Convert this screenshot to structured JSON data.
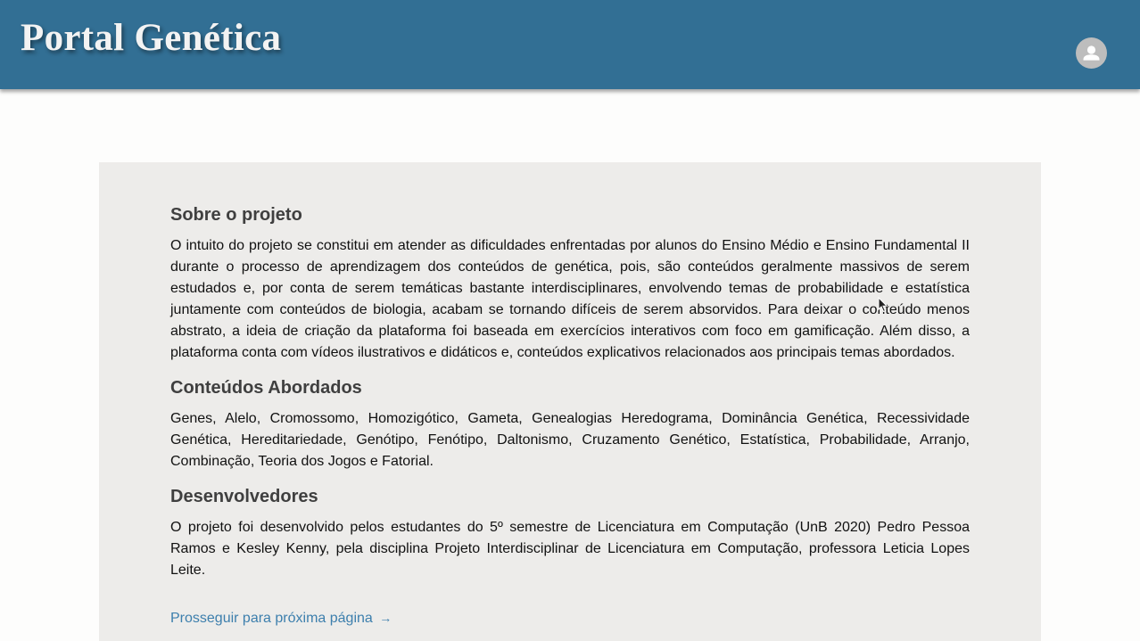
{
  "header": {
    "title": "Portal Genética",
    "avatar_icon": "account-circle-icon",
    "background": "#326f94"
  },
  "sections": {
    "about": {
      "heading": "Sobre o projeto",
      "body": "O intuito do projeto se constitui em atender as dificuldades enfrentadas por alunos do Ensino Médio e Ensino Fundamental II durante o processo de aprendizagem dos conteúdos de genética, pois, são conteúdos geralmente massivos de serem estudados e, por conta de serem temáticas bastante interdisciplinares, envolvendo temas de probabilidade e estatística juntamente com conteúdos de biologia, acabam se tornando difíceis de serem absorvidos. Para deixar o conteúdo menos abstrato, a ideia de criação da plataforma foi baseada em exercícios interativos com foco em gamificação. Além disso, a plataforma conta com vídeos ilustrativos e didáticos e, conteúdos explicativos relacionados aos principais temas abordados."
    },
    "topics": {
      "heading": "Conteúdos Abordados",
      "body": "Genes, Alelo, Cromossomo, Homozigótico, Gameta, Genealogias Heredograma, Dominância Genética, Recessividade Genética, Hereditariedade, Genótipo, Fenótipo, Daltonismo, Cruzamento Genético, Estatística, Probabilidade, Arranjo, Combinação, Teoria dos Jogos e Fatorial."
    },
    "developers": {
      "heading": "Desenvolvedores",
      "body": "O projeto foi desenvolvido pelos estudantes do 5º semestre de Licenciatura em Computação (UnB 2020) Pedro Pessoa Ramos e Kesley Kenny, pela disciplina Projeto Interdisciplinar de Licenciatura em Computação, professora Leticia Lopes Leite."
    }
  },
  "next_link": {
    "label": "Prosseguir para próxima página",
    "arrow": "→"
  }
}
